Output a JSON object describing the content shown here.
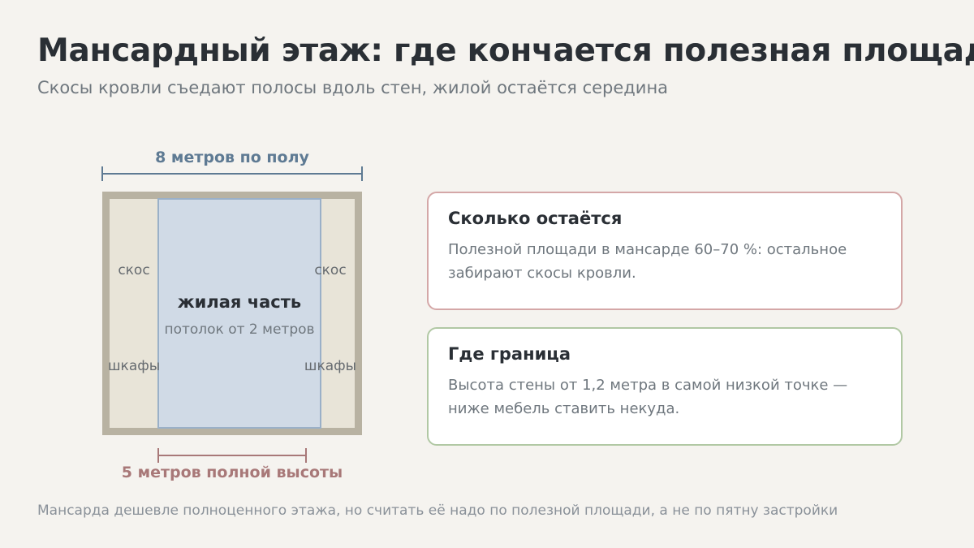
{
  "header": {
    "title": "Мансардный этаж: где кончается полезная площадь",
    "subtitle": "Скосы кровли съедают полосы вдоль стен, жилой остаётся середина"
  },
  "diagram": {
    "floor_width_label": "8 метров по полу",
    "full_height_label": "5 метров полной высоты",
    "slope_left_label": "скос",
    "slope_right_label": "скос",
    "cabinets_left_label": "шкафы",
    "cabinets_right_label": "шкафы",
    "living_title": "жилая часть",
    "living_subtitle": "потолок от 2 метров"
  },
  "cards": [
    {
      "title": "Сколько остаётся",
      "line1": "Полезной площади в мансарде 60–70 %: остальное",
      "line2": "забирают скосы кровли.",
      "accent": "#d4a7a7"
    },
    {
      "title": "Где граница",
      "line1": "Высота стены от 1,2 метра в самой низкой точке —",
      "line2": "ниже мебель ставить некуда.",
      "accent": "#b1c8a4"
    }
  ],
  "footer": "Мансарда дешевле полноценного этажа, но считать её надо по полезной площади, а не по пятну застройки"
}
